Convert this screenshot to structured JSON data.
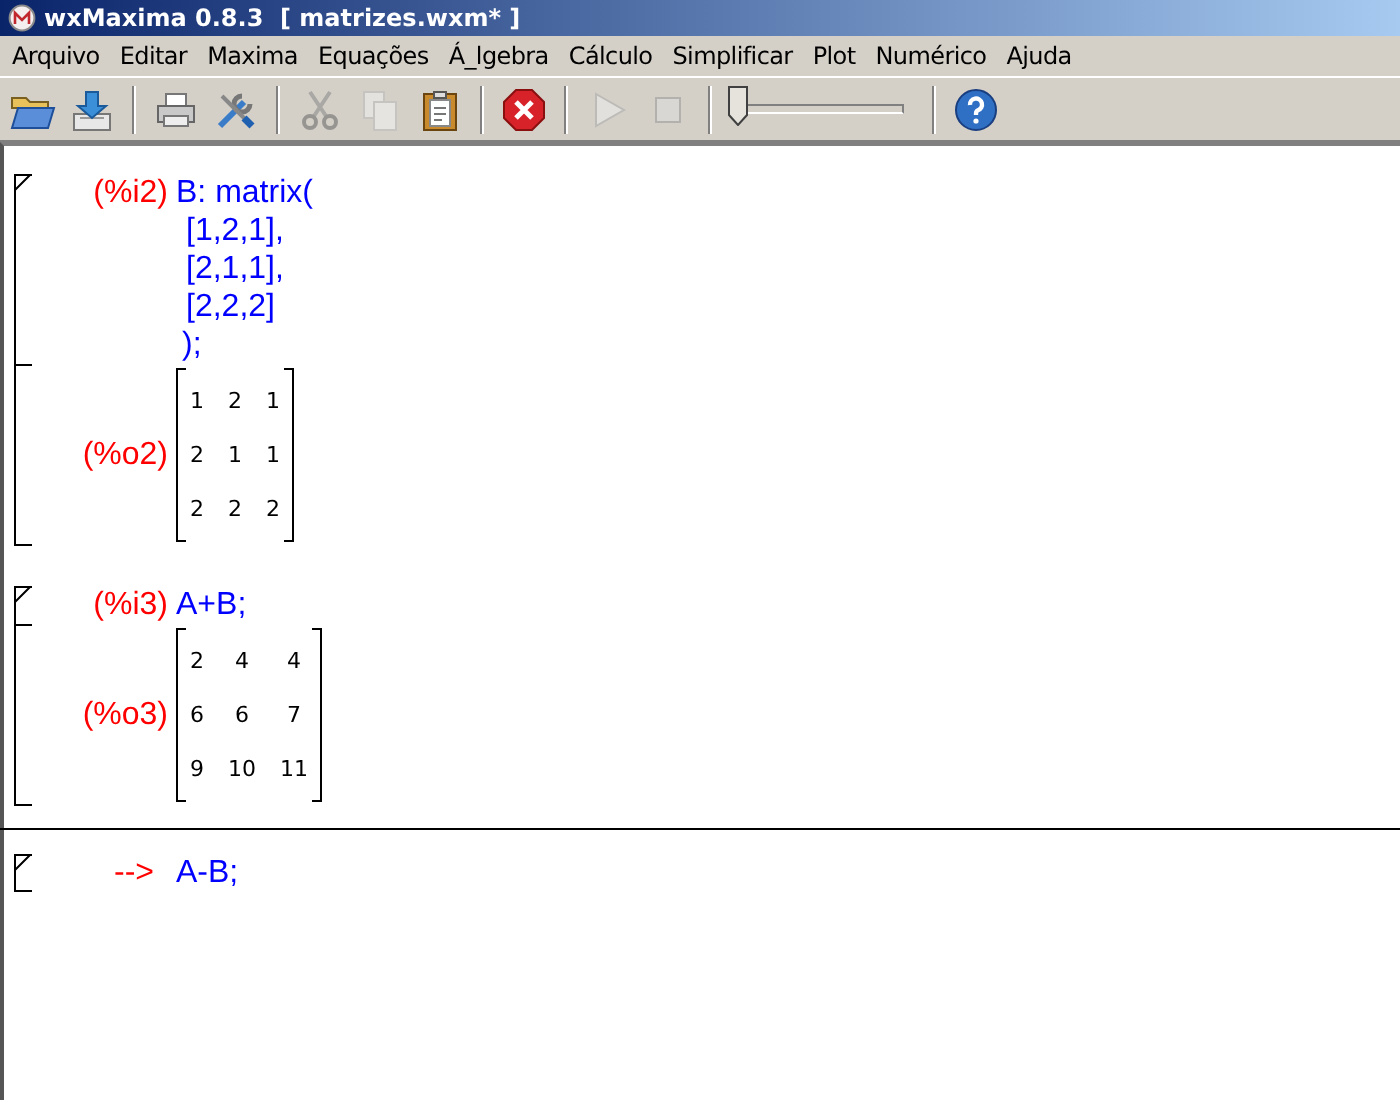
{
  "window": {
    "title": "wxMaxima 0.8.3  [ matrizes.wxm* ]"
  },
  "menu": [
    "Arquivo",
    "Editar",
    "Maxima",
    "Equações",
    "Á_lgebra",
    "Cálculo",
    "Simplificar",
    "Plot",
    "Numérico",
    "Ajuda"
  ],
  "toolbar": {
    "buttons": [
      {
        "disabled": false
      },
      {
        "disabled": false
      },
      {
        "disabled": false
      },
      {
        "disabled": false
      },
      {
        "disabled": true
      },
      {
        "disabled": true
      },
      {
        "disabled": false
      },
      {
        "disabled": false
      },
      {
        "disabled": true
      },
      {
        "disabled": true
      },
      {
        "disabled": false
      }
    ],
    "slider": {
      "level": 0
    }
  },
  "cells": [
    {
      "kind": "evaluated",
      "cursor_above": false,
      "input_label": "(%i2)",
      "input": [
        "B: matrix(",
        "[1,2,1],",
        "[2,1,1],",
        "[2,2,2]",
        ");"
      ],
      "output_label": "(%o2)",
      "matrix": [
        [
          "1",
          "2",
          "1"
        ],
        [
          "2",
          "1",
          "1"
        ],
        [
          "2",
          "2",
          "2"
        ]
      ]
    },
    {
      "kind": "evaluated",
      "cursor_above": false,
      "input_label": "(%i3)",
      "input": [
        "A+B;"
      ],
      "output_label": "(%o3)",
      "matrix": [
        [
          "2",
          "4",
          "4"
        ],
        [
          "6",
          "6",
          "7"
        ],
        [
          "9",
          "10",
          "11"
        ]
      ]
    },
    {
      "kind": "new",
      "cursor_above": true,
      "input_label": "-->",
      "input": [
        "A-B;"
      ]
    }
  ]
}
